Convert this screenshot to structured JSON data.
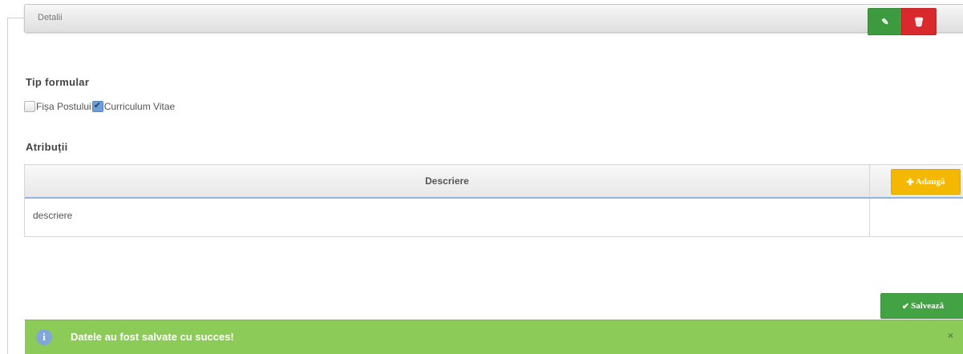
{
  "panel": {
    "title": "Detalii"
  },
  "form_type": {
    "heading": "Tip formular",
    "options": [
      {
        "label": "Fișa Postului",
        "checked": false
      },
      {
        "label": "Curriculum Vitae",
        "checked": true
      }
    ]
  },
  "attributes": {
    "heading": "Atribuții",
    "table": {
      "header_desc": "Descriere",
      "add_icon": "plus-icon",
      "add_label": "Adaugă",
      "rows": [
        {
          "desc": "descriere",
          "edit_icon": "edit-icon",
          "delete_icon": "trash-icon"
        }
      ]
    }
  },
  "save_button": {
    "icon": "check-icon",
    "label": "Salvează"
  },
  "alert": {
    "icon": "info-icon",
    "message": "Datele au fost salvate cu succes!",
    "close_icon": "close-icon",
    "color": "#8ccb57"
  },
  "colors": {
    "add_button": "#f5b800",
    "edit_button": "#3e9a3e",
    "delete_button": "#d9292c",
    "save_button": "#43a243"
  }
}
